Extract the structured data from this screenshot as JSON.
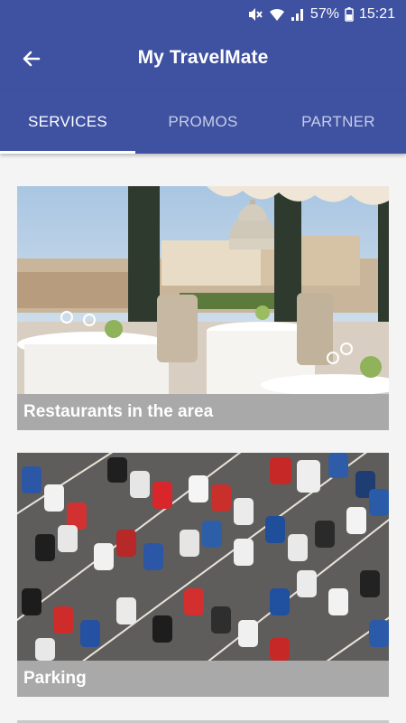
{
  "status_bar": {
    "battery": "57%",
    "time": "15:21",
    "icons": [
      "mute-icon",
      "wifi-icon",
      "signal-icon",
      "battery-icon"
    ]
  },
  "app_bar": {
    "back_icon": "arrow-left-icon",
    "title": "My TravelMate"
  },
  "tabs": [
    {
      "label": "SERVICES",
      "active": true
    },
    {
      "label": "PROMOS",
      "active": false
    },
    {
      "label": "PARTNER",
      "active": false
    }
  ],
  "services": [
    {
      "label": "Restaurants in the area",
      "image": "restaurant-with-city-view"
    },
    {
      "label": "Parking",
      "image": "parking-lot-aerial"
    }
  ],
  "colors": {
    "primary": "#3f51a1",
    "caption_bg": "#a9a9a9",
    "background": "#f4f4f4"
  }
}
